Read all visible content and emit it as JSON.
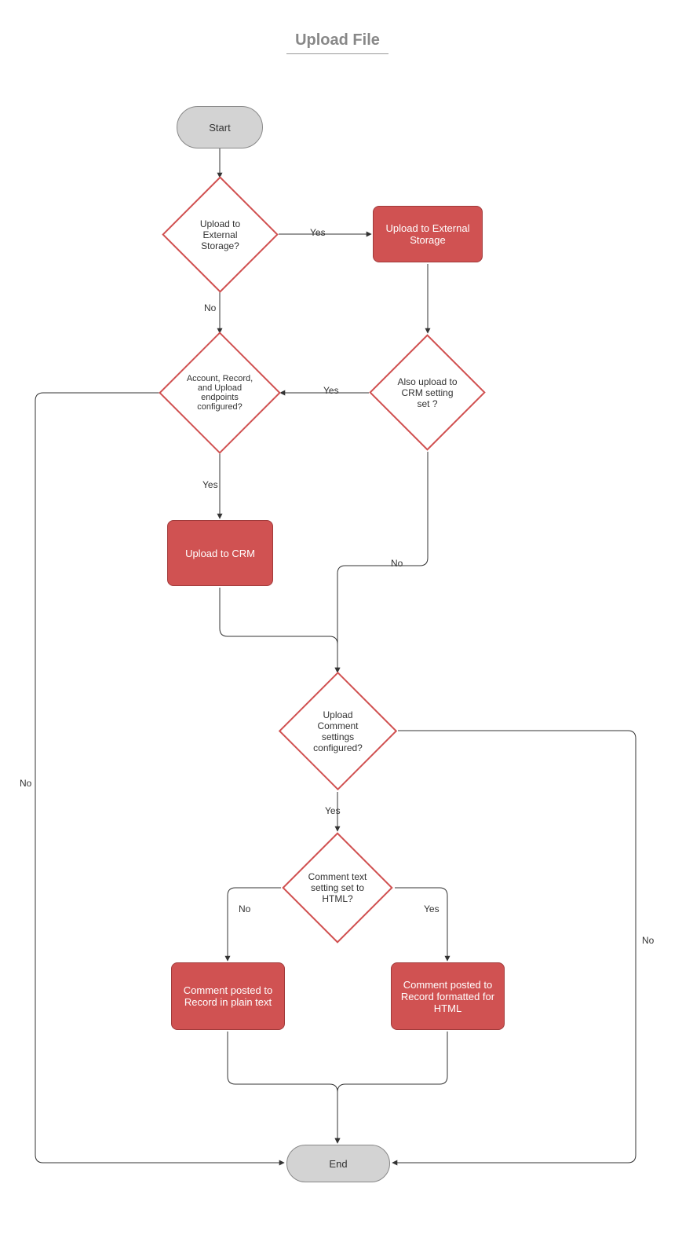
{
  "title": "Upload File",
  "nodes": {
    "start": "Start",
    "end": "End",
    "d_ext_storage": "Upload to External Storage?",
    "p_ext_storage": "Upload to External Storage",
    "d_also_crm": "Also upload to CRM setting set ?",
    "d_endpoints": "Account, Record, and Upload endpoints configured?",
    "p_upload_crm": "Upload to CRM",
    "d_comment_cfg": "Upload Comment settings configured?",
    "d_html": "Comment text setting set to HTML?",
    "p_plain": "Comment posted to Record in plain text",
    "p_html": "Comment posted to Record formatted for HTML"
  },
  "labels": {
    "yes": "Yes",
    "no": "No"
  },
  "colors": {
    "accent": "#d05252",
    "accent_border": "#a03a3a",
    "terminator_fill": "#d3d3d3",
    "title_color": "#888888"
  },
  "chart_data": {
    "type": "flowchart",
    "title": "Upload File",
    "nodes": [
      {
        "id": "start",
        "type": "terminator",
        "label": "Start"
      },
      {
        "id": "d_ext",
        "type": "decision",
        "label": "Upload to External Storage?"
      },
      {
        "id": "p_ext",
        "type": "process",
        "label": "Upload to External Storage"
      },
      {
        "id": "d_also_crm",
        "type": "decision",
        "label": "Also upload to CRM setting set ?"
      },
      {
        "id": "d_endpoints",
        "type": "decision",
        "label": "Account, Record, and Upload endpoints configured?"
      },
      {
        "id": "p_crm",
        "type": "process",
        "label": "Upload to CRM"
      },
      {
        "id": "d_comment_cfg",
        "type": "decision",
        "label": "Upload Comment settings configured?"
      },
      {
        "id": "d_html",
        "type": "decision",
        "label": "Comment text setting set to HTML?"
      },
      {
        "id": "p_plain",
        "type": "process",
        "label": "Comment posted to Record in plain text"
      },
      {
        "id": "p_html",
        "type": "process",
        "label": "Comment posted to Record formatted for HTML"
      },
      {
        "id": "end",
        "type": "terminator",
        "label": "End"
      }
    ],
    "edges": [
      {
        "from": "start",
        "to": "d_ext"
      },
      {
        "from": "d_ext",
        "to": "p_ext",
        "label": "Yes"
      },
      {
        "from": "d_ext",
        "to": "d_endpoints",
        "label": "No"
      },
      {
        "from": "p_ext",
        "to": "d_also_crm"
      },
      {
        "from": "d_also_crm",
        "to": "d_endpoints",
        "label": "Yes"
      },
      {
        "from": "d_also_crm",
        "to": "d_comment_cfg",
        "label": "No"
      },
      {
        "from": "d_endpoints",
        "to": "p_crm",
        "label": "Yes"
      },
      {
        "from": "d_endpoints",
        "to": "end",
        "label": "No"
      },
      {
        "from": "p_crm",
        "to": "d_comment_cfg"
      },
      {
        "from": "d_comment_cfg",
        "to": "d_html",
        "label": "Yes"
      },
      {
        "from": "d_comment_cfg",
        "to": "end",
        "label": "No"
      },
      {
        "from": "d_html",
        "to": "p_html",
        "label": "Yes"
      },
      {
        "from": "d_html",
        "to": "p_plain",
        "label": "No"
      },
      {
        "from": "p_plain",
        "to": "end"
      },
      {
        "from": "p_html",
        "to": "end"
      }
    ]
  }
}
